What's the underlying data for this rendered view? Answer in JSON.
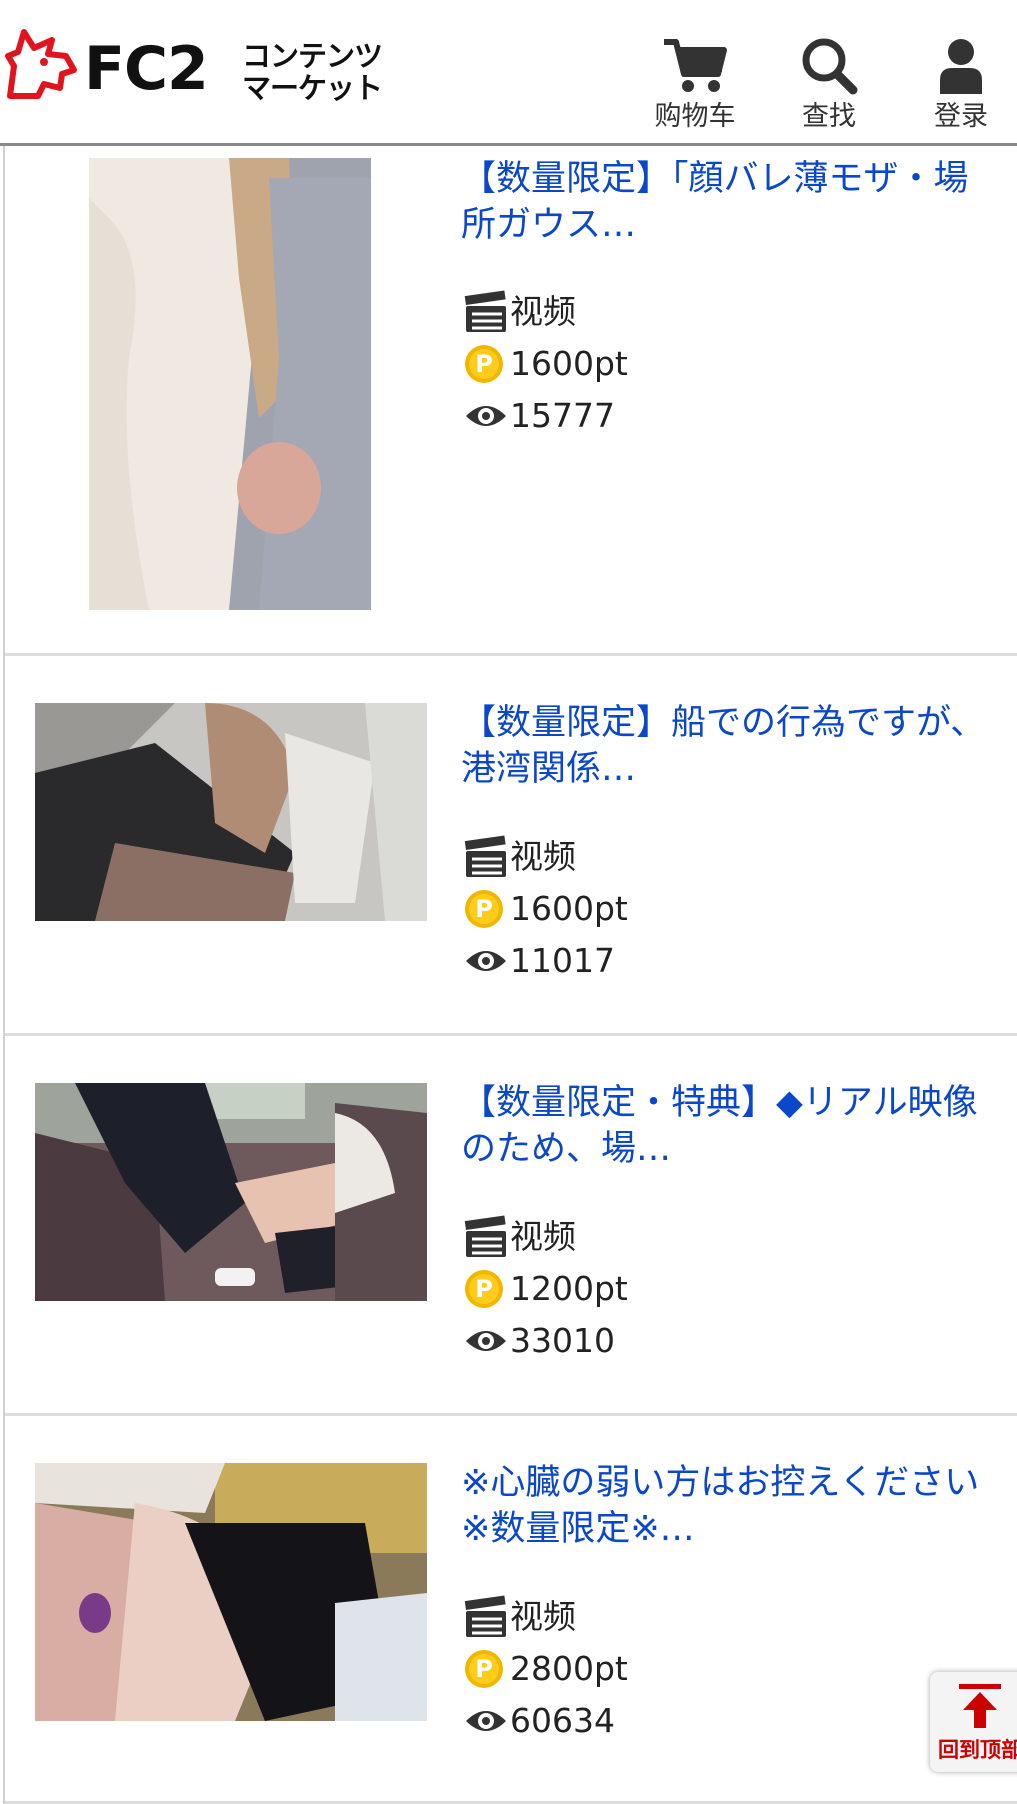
{
  "header": {
    "logo_text": "FC2",
    "logo_sub_line1": "コンテンツ",
    "logo_sub_line2": "マーケット",
    "nav": [
      {
        "label": "购物车",
        "icon": "cart-icon"
      },
      {
        "label": "查找",
        "icon": "search-icon"
      },
      {
        "label": "登录",
        "icon": "user-icon"
      }
    ]
  },
  "items": [
    {
      "title": "【数量限定】「顔バレ薄モザ・場所ガウス…",
      "type": "视频",
      "price": "1600pt",
      "views": "15777"
    },
    {
      "title": "【数量限定】船での行為ですが、港湾関係…",
      "type": "视频",
      "price": "1600pt",
      "views": "11017"
    },
    {
      "title": "【数量限定・特典】◆リアル映像のため、場…",
      "type": "视频",
      "price": "1200pt",
      "views": "33010"
    },
    {
      "title": "※心臓の弱い方はお控えください※数量限定※…",
      "type": "视频",
      "price": "2800pt",
      "views": "60634"
    }
  ],
  "back_to_top": {
    "label": "回到顶部"
  },
  "colors": {
    "title_link": "#0a47c9",
    "back_to_top": "#cc0000",
    "logo_red": "#e0141e"
  }
}
